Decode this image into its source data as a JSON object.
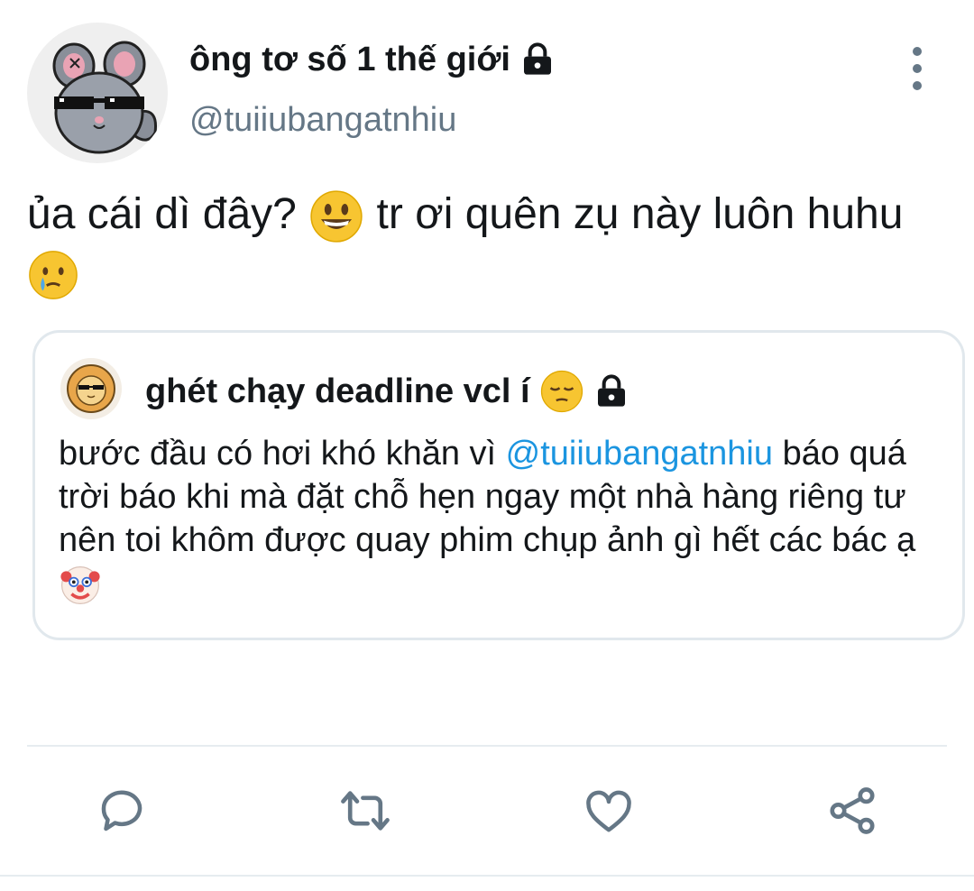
{
  "tweet": {
    "display_name": "ông tơ số 1 thế giới",
    "handle": "@tuiiubangatnhiu",
    "text_part1": "ủa cái dì đây? ",
    "text_part2": " tr ơi quên zụ này luôn huhu ",
    "emoji_1": "grinning-face",
    "emoji_2": "crying-face"
  },
  "quoted_tweet": {
    "display_name": "ghét chạy deadline vcl í",
    "text_before_mention": "bước đầu có hơi khó khăn vì ",
    "mention": "@tuiiubangatnhiu",
    "text_after_mention": " báo quá trời báo khi mà đặt chỗ hẹn ngay một nhà hàng riêng tư nên toi khôm được quay phim chụp ảnh gì hết các bác ạ ",
    "emoji_name": "pensive-face",
    "emoji_end": "clown-face"
  },
  "actions": [
    "reply",
    "retweet",
    "like",
    "share"
  ],
  "colors": {
    "text": "#14171a",
    "secondary": "#657786",
    "mention": "#1b95e0",
    "border": "#e1e8ed"
  }
}
